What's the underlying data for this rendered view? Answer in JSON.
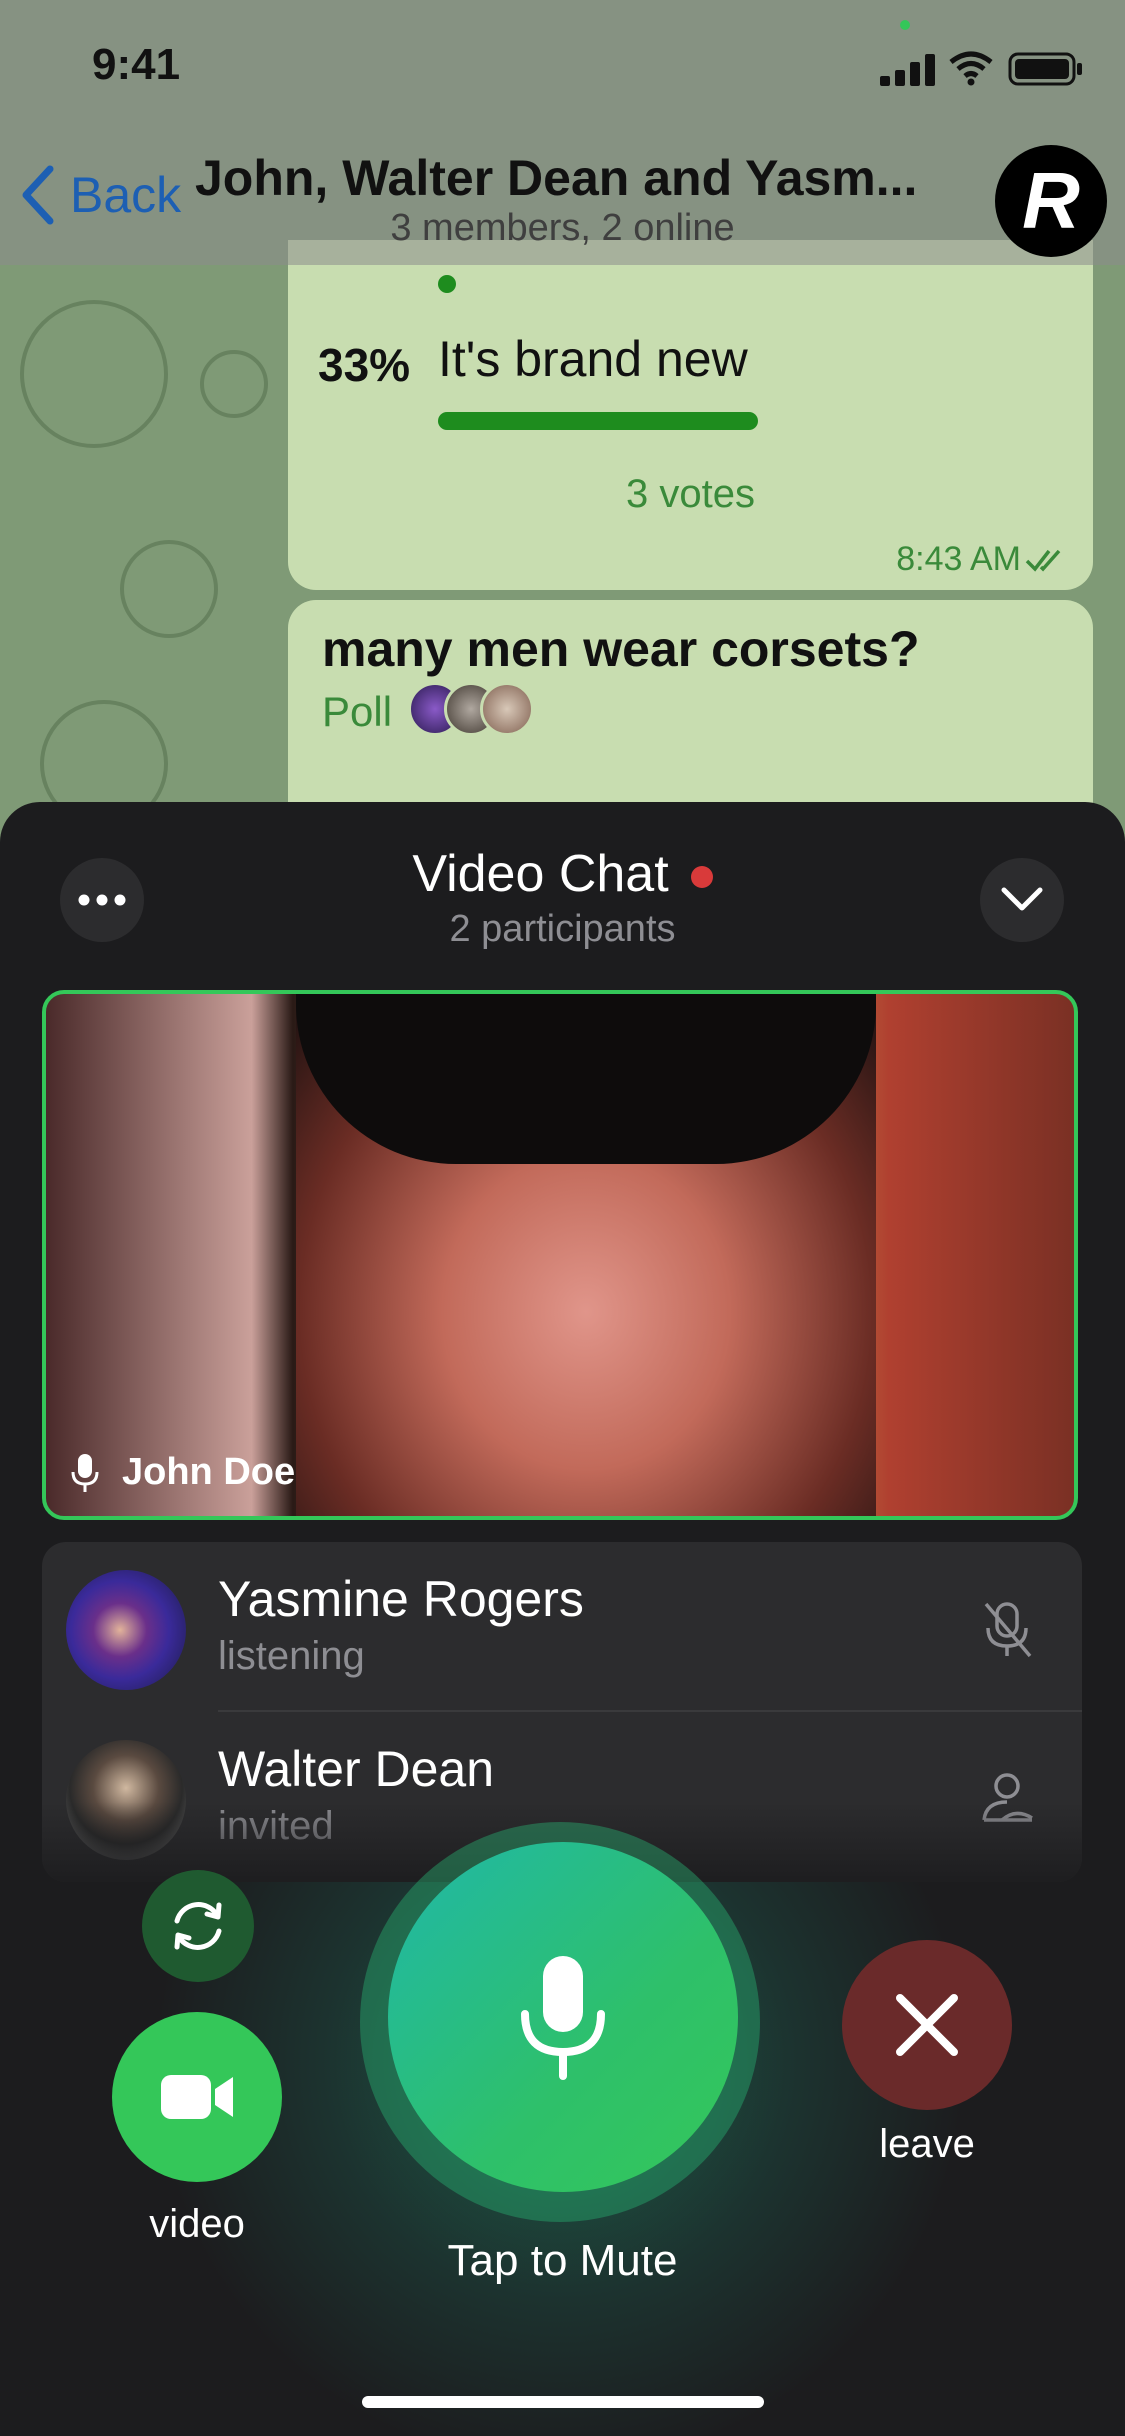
{
  "status_bar": {
    "time": "9:41"
  },
  "nav": {
    "back_label": "Back",
    "title": "John, Walter Dean and Yasm...",
    "subtitle": "3 members, 2 online",
    "avatar_letter": "R"
  },
  "messages": {
    "poll1": {
      "option_percent": "33%",
      "option_text": "It's brand new",
      "option_fraction": 0.33,
      "votes": "3 votes",
      "time": "8:43 AM"
    },
    "poll2": {
      "question": "many men wear corsets?",
      "label": "Poll"
    }
  },
  "video_chat": {
    "title": "Video Chat",
    "subtitle": "2 participants",
    "speaker_name": "John Doe",
    "participants": [
      {
        "name": "Yasmine Rogers",
        "status": "listening",
        "icon": "mic-muted-icon"
      },
      {
        "name": "Walter Dean",
        "status": "invited",
        "icon": "invited-user-icon"
      }
    ],
    "controls": {
      "video_label": "video",
      "mute_label": "Tap to Mute",
      "leave_label": "leave"
    }
  },
  "colors": {
    "accent_green": "#34c759",
    "leave_red": "#6a2a2a",
    "record_dot": "#d93a3a",
    "link_blue": "#1d5fb3"
  }
}
